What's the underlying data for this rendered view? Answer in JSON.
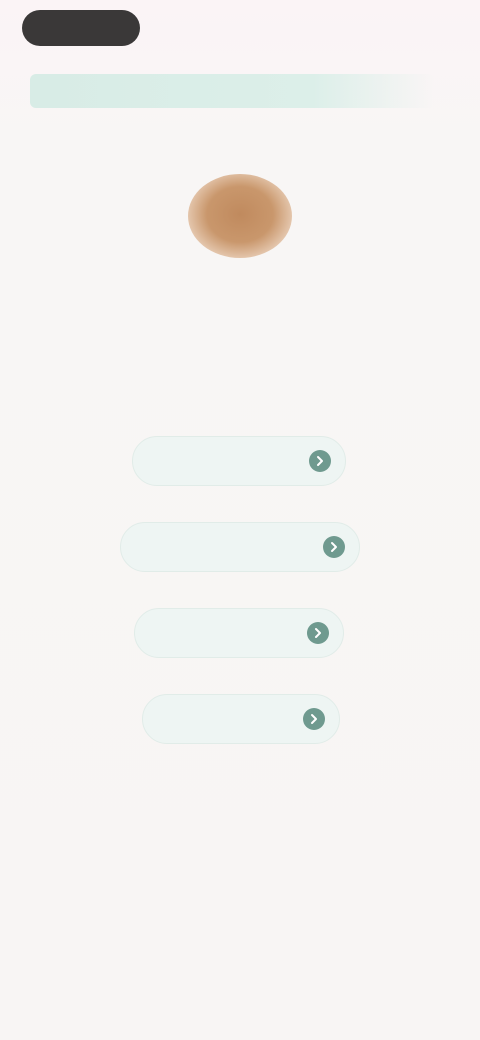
{
  "header": {
    "pill_label": "",
    "subtitle": ""
  },
  "question": {
    "prompt": ""
  },
  "choices": [
    {
      "label": "",
      "icon": "arrow-right-icon"
    },
    {
      "label": "",
      "icon": "arrow-right-icon"
    },
    {
      "label": "",
      "icon": "arrow-right-icon"
    },
    {
      "label": "",
      "icon": "arrow-right-icon"
    }
  ],
  "colors": {
    "background": "#f8f6f5",
    "accent": "#6f9a8f",
    "choice_background": "#eef5f3",
    "pill_background": "#3a3838",
    "avatar": "#c08a5e"
  }
}
